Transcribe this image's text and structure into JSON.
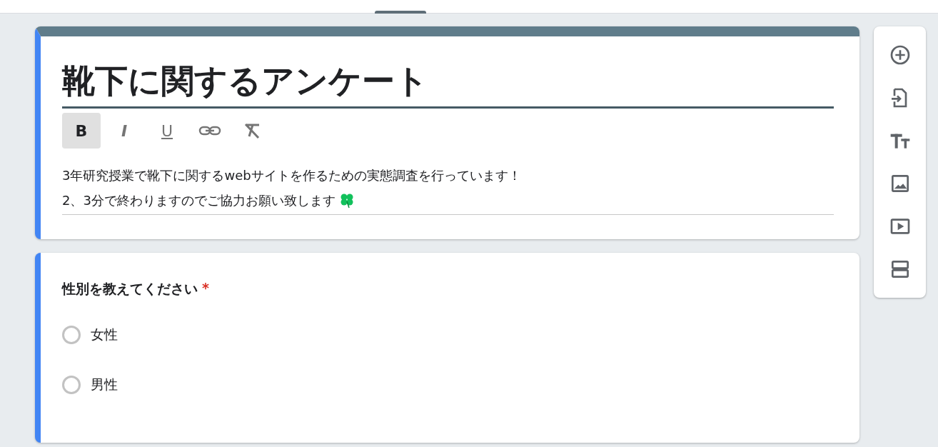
{
  "form": {
    "title": "靴下に関するアンケート",
    "format_buttons": [
      {
        "kind": "bold",
        "label": "B",
        "selected": true
      },
      {
        "kind": "italic",
        "label": "I",
        "selected": false
      },
      {
        "kind": "underline",
        "label": "U",
        "selected": false
      },
      {
        "kind": "link",
        "selected": false
      },
      {
        "kind": "clear",
        "selected": false
      }
    ],
    "description": [
      "3年研究授業で靴下に関するwebサイトを作るための実態調査を行っています！",
      "2、3分で終わりますのでご協力お願い致します"
    ]
  },
  "questions": [
    {
      "title": "性別を教えてください",
      "required_mark": "*",
      "options": [
        {
          "label": "女性",
          "selected": false
        },
        {
          "label": "男性",
          "selected": false
        }
      ]
    }
  ],
  "side_toolbar": [
    {
      "kind": "add"
    },
    {
      "kind": "import"
    },
    {
      "kind": "title"
    },
    {
      "kind": "image"
    },
    {
      "kind": "video"
    },
    {
      "kind": "section"
    }
  ]
}
